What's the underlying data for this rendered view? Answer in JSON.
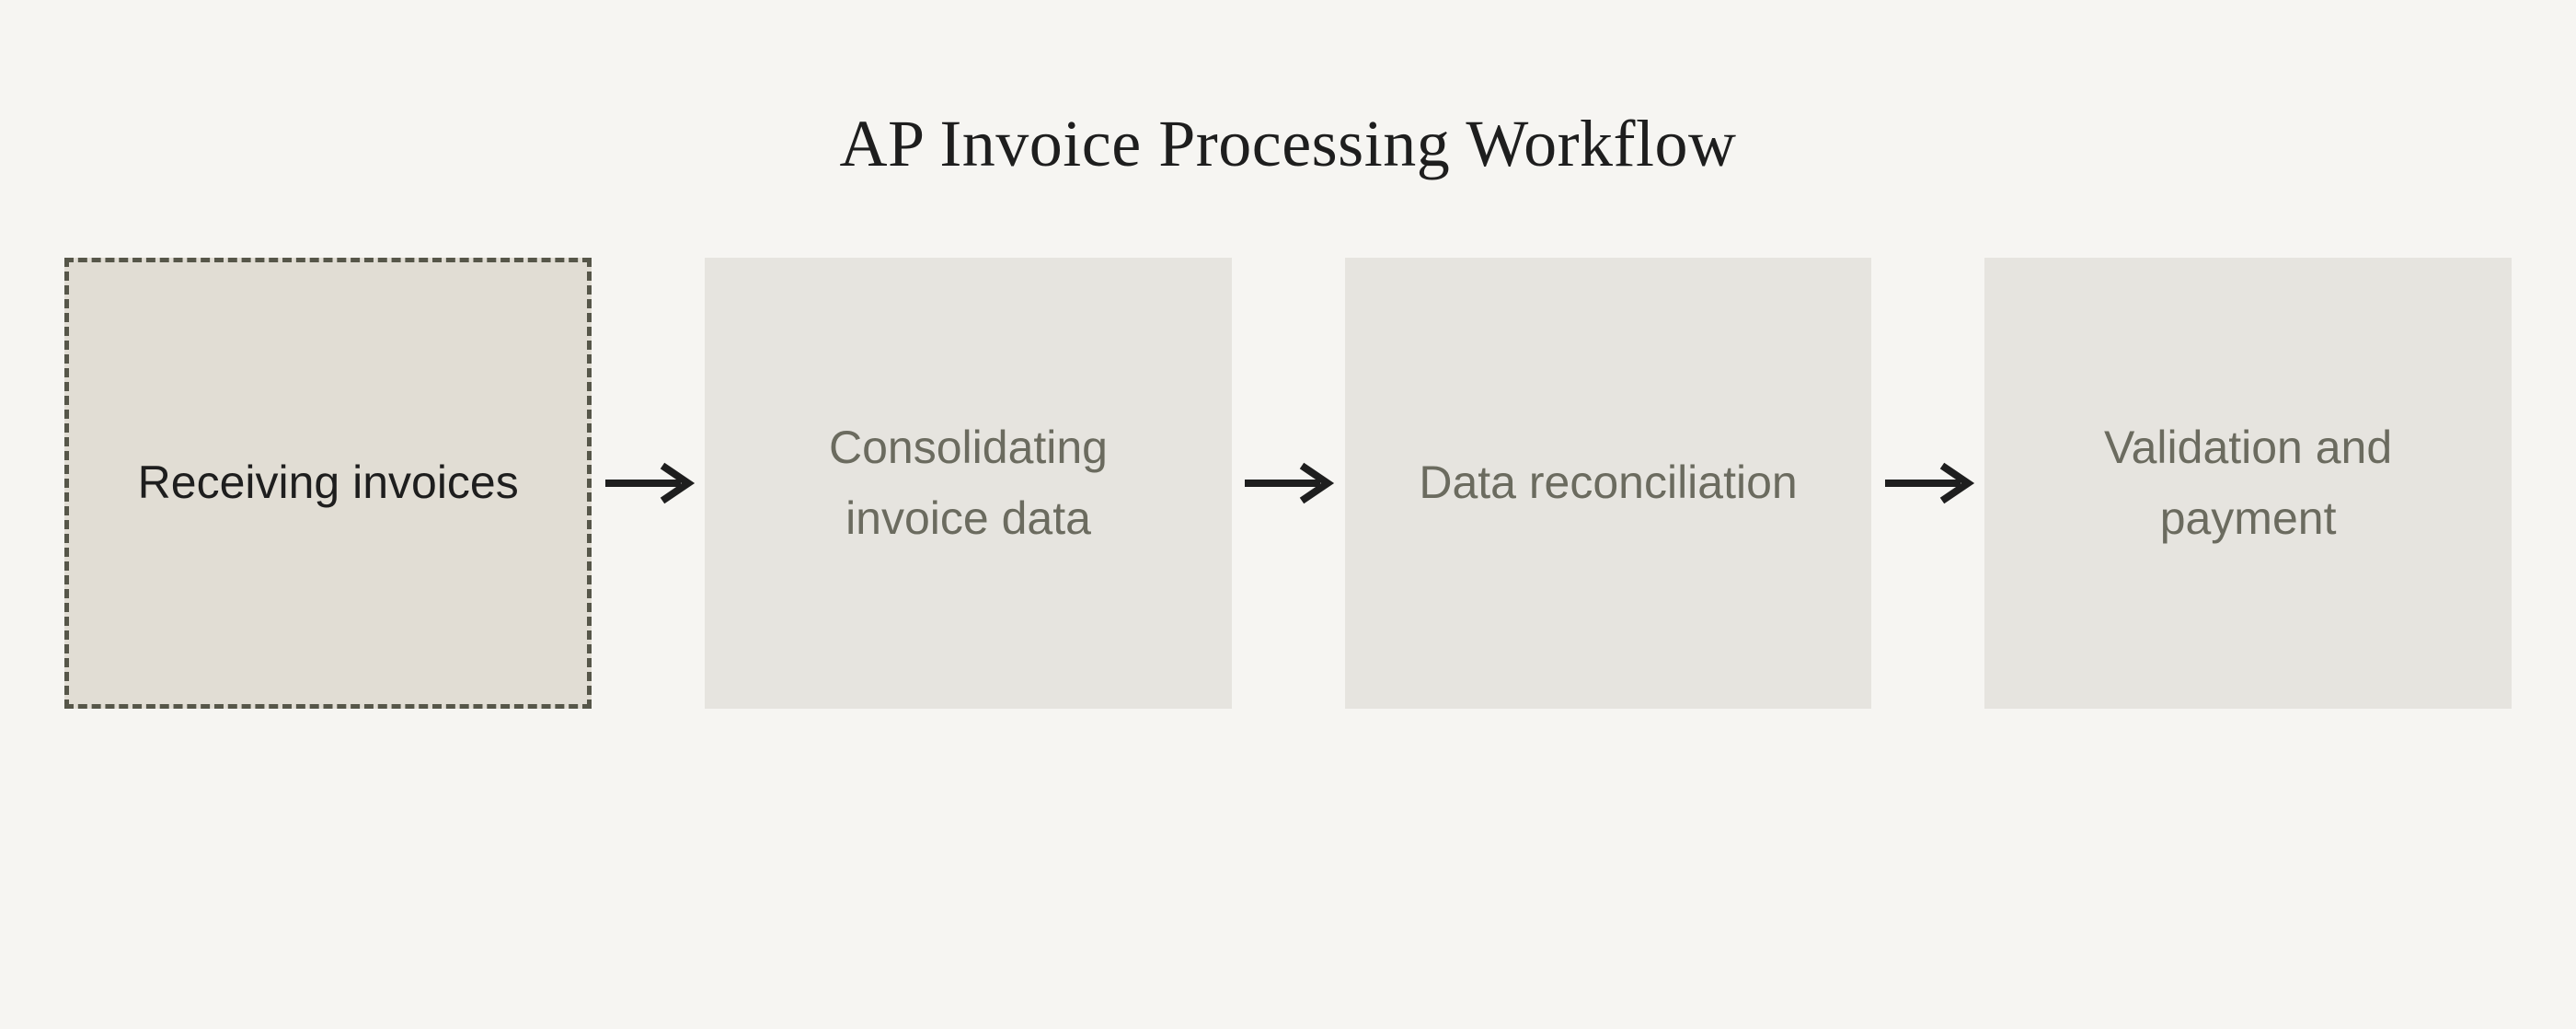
{
  "title": "AP Invoice Processing Workflow",
  "steps": [
    {
      "label": "Receiving invoices",
      "active": true
    },
    {
      "label": "Consolidating invoice data",
      "active": false
    },
    {
      "label": "Data reconciliation",
      "active": false
    },
    {
      "label": "Validation and payment",
      "active": false
    }
  ]
}
